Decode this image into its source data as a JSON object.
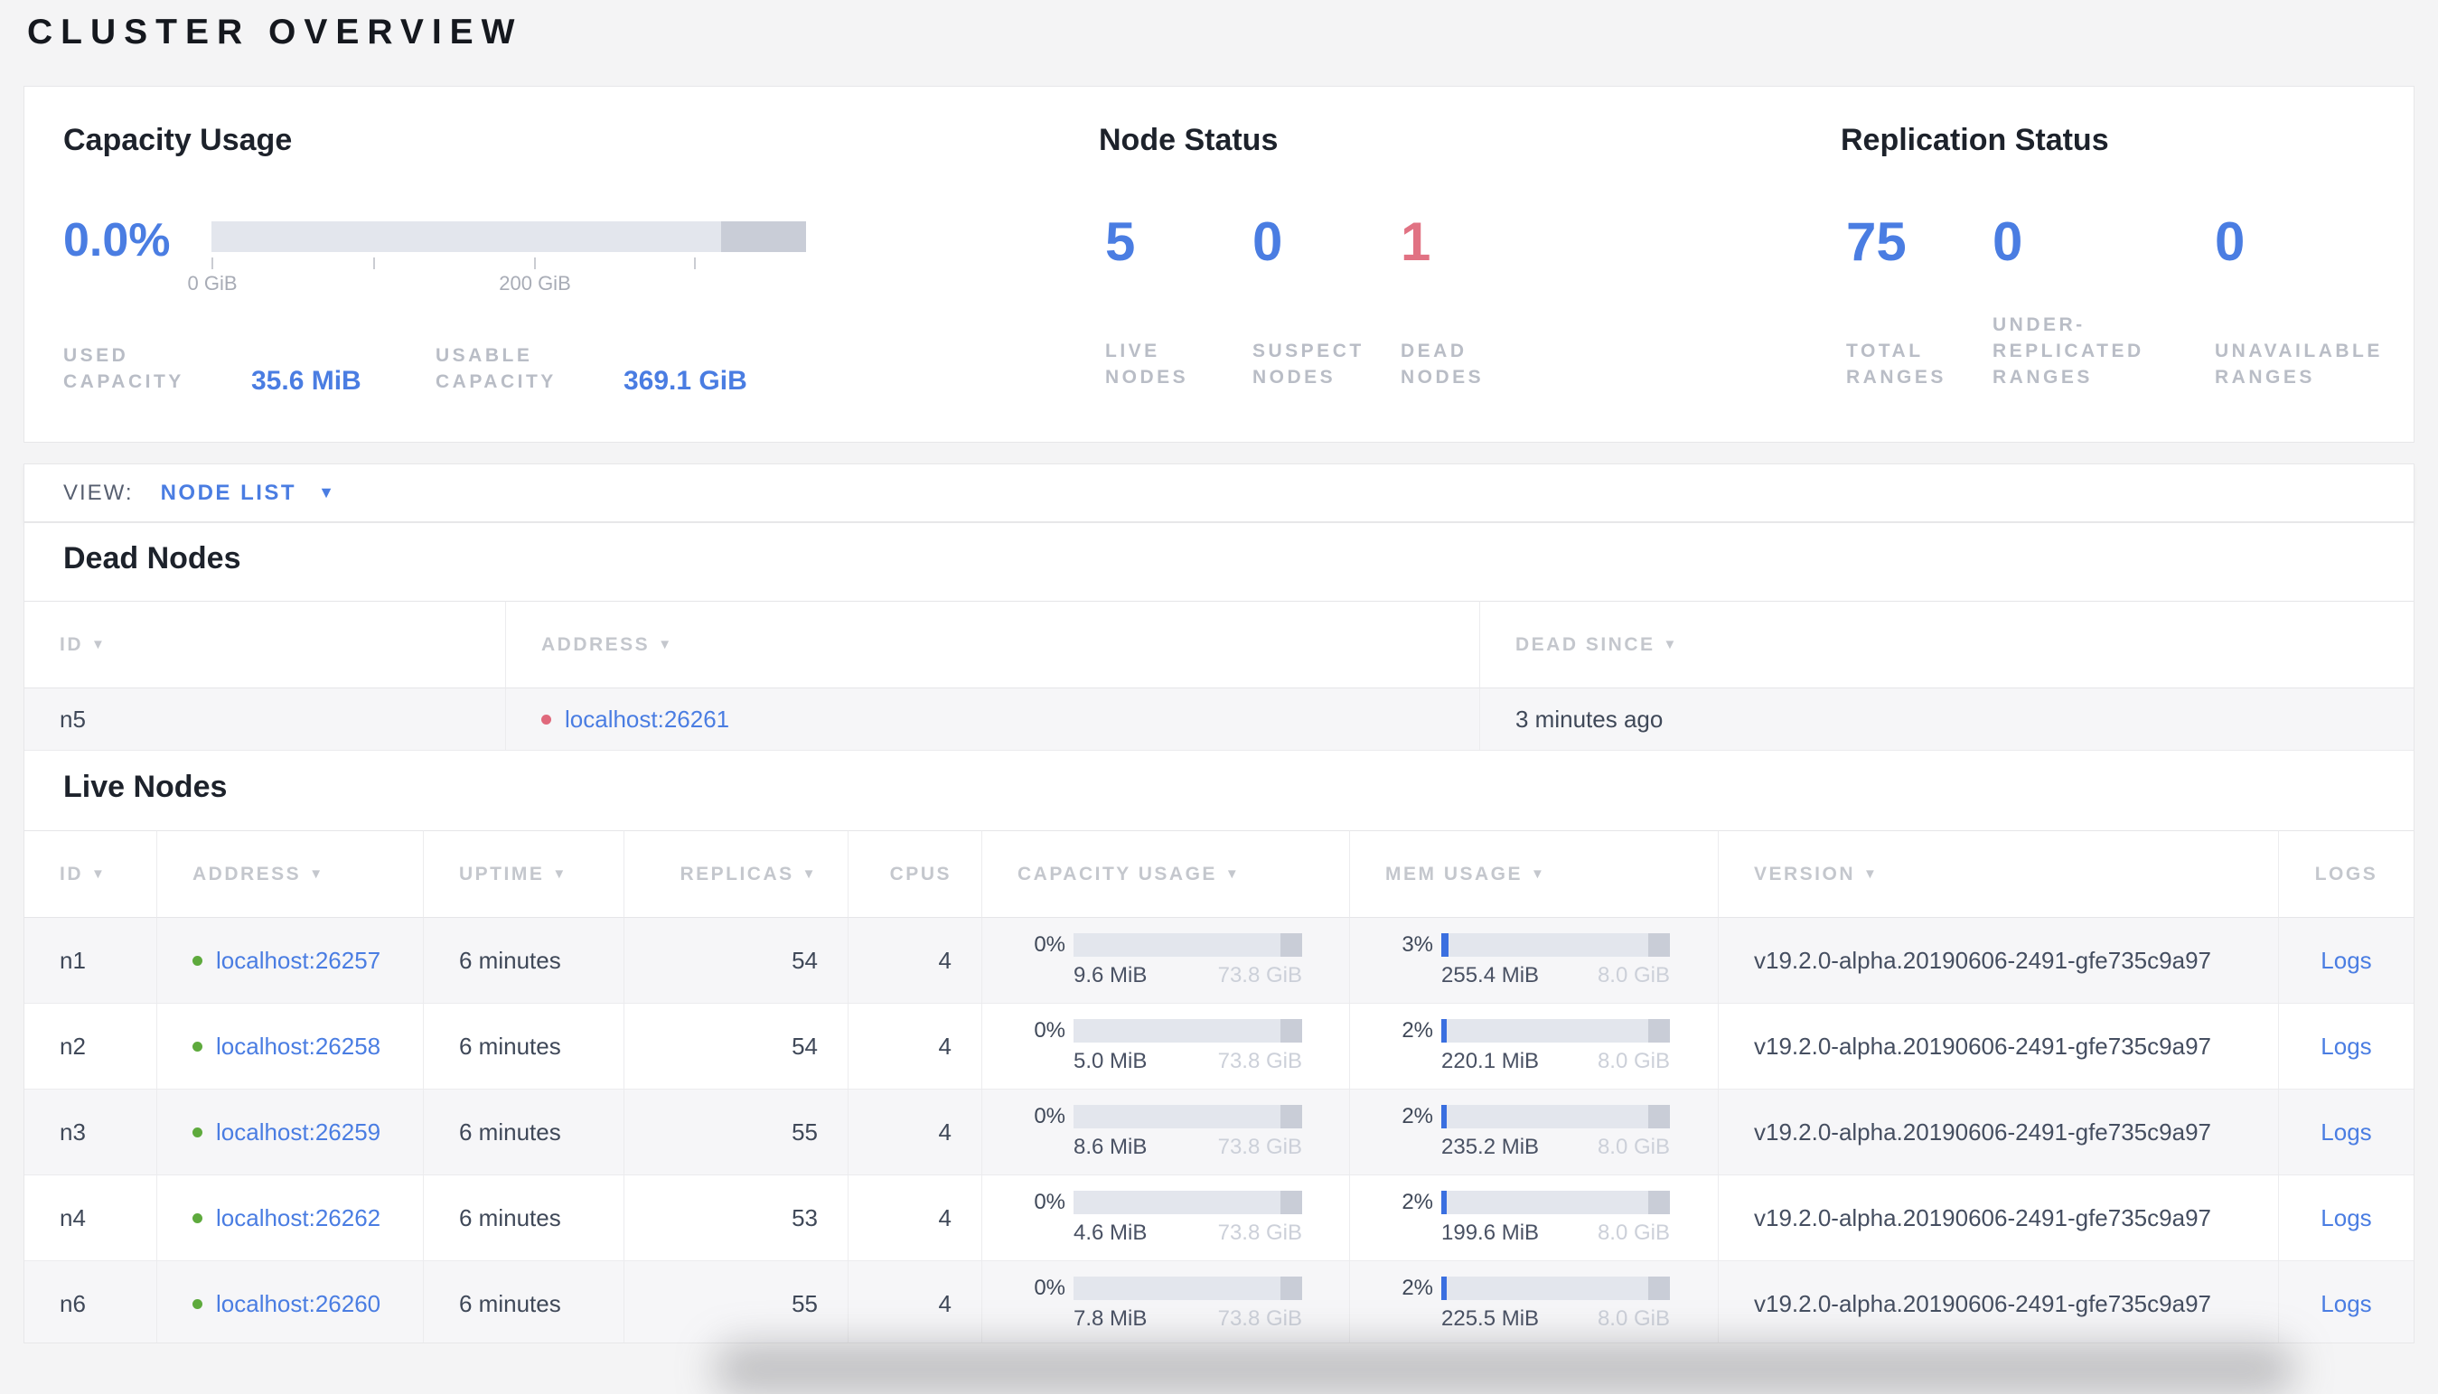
{
  "title": "CLUSTER OVERVIEW",
  "colors": {
    "accent_blue": "#4a7de2",
    "danger_red": "#e17283",
    "live_green": "#5eaa3d",
    "dead_red": "#e0697c"
  },
  "summary": {
    "capacity": {
      "heading": "Capacity Usage",
      "percent": "0.0%",
      "tick_labels": [
        "0 GiB",
        "200 GiB"
      ],
      "used_label": "USED CAPACITY",
      "used_value": "35.6 MiB",
      "usable_label": "USABLE CAPACITY",
      "usable_value": "369.1 GiB"
    },
    "nodes": {
      "heading": "Node Status",
      "stats": [
        {
          "value": "5",
          "label": "LIVE NODES"
        },
        {
          "value": "0",
          "label": "SUSPECT NODES"
        },
        {
          "value": "1",
          "label": "DEAD NODES"
        }
      ]
    },
    "replication": {
      "heading": "Replication Status",
      "stats": [
        {
          "value": "75",
          "label": "TOTAL RANGES"
        },
        {
          "value": "0",
          "label": "UNDER-REPLICATED RANGES"
        },
        {
          "value": "0",
          "label": "UNAVAILABLE RANGES"
        }
      ]
    }
  },
  "view_bar": {
    "label": "VIEW:",
    "selected": "NODE LIST"
  },
  "dead_nodes": {
    "heading": "Dead Nodes",
    "columns": [
      "ID",
      "ADDRESS",
      "DEAD SINCE"
    ],
    "rows": [
      {
        "id": "n5",
        "address": "localhost:26261",
        "dead_since": "3 minutes ago"
      }
    ]
  },
  "live_nodes": {
    "heading": "Live Nodes",
    "columns": [
      "ID",
      "ADDRESS",
      "UPTIME",
      "REPLICAS",
      "CPUS",
      "CAPACITY USAGE",
      "MEM USAGE",
      "VERSION",
      "LOGS"
    ],
    "rows": [
      {
        "id": "n1",
        "address": "localhost:26257",
        "uptime": "6 minutes",
        "replicas": "54",
        "cpus": "4",
        "capacity_percent": "0%",
        "capacity_used": "9.6 MiB",
        "capacity_total": "73.8 GiB",
        "mem_percent": "3%",
        "mem_used": "255.4 MiB",
        "mem_total": "8.0 GiB",
        "version": "v19.2.0-alpha.20190606-2491-gfe735c9a97",
        "logs": "Logs"
      },
      {
        "id": "n2",
        "address": "localhost:26258",
        "uptime": "6 minutes",
        "replicas": "54",
        "cpus": "4",
        "capacity_percent": "0%",
        "capacity_used": "5.0 MiB",
        "capacity_total": "73.8 GiB",
        "mem_percent": "2%",
        "mem_used": "220.1 MiB",
        "mem_total": "8.0 GiB",
        "version": "v19.2.0-alpha.20190606-2491-gfe735c9a97",
        "logs": "Logs"
      },
      {
        "id": "n3",
        "address": "localhost:26259",
        "uptime": "6 minutes",
        "replicas": "55",
        "cpus": "4",
        "capacity_percent": "0%",
        "capacity_used": "8.6 MiB",
        "capacity_total": "73.8 GiB",
        "mem_percent": "2%",
        "mem_used": "235.2 MiB",
        "mem_total": "8.0 GiB",
        "version": "v19.2.0-alpha.20190606-2491-gfe735c9a97",
        "logs": "Logs"
      },
      {
        "id": "n4",
        "address": "localhost:26262",
        "uptime": "6 minutes",
        "replicas": "53",
        "cpus": "4",
        "capacity_percent": "0%",
        "capacity_used": "4.6 MiB",
        "capacity_total": "73.8 GiB",
        "mem_percent": "2%",
        "mem_used": "199.6 MiB",
        "mem_total": "8.0 GiB",
        "version": "v19.2.0-alpha.20190606-2491-gfe735c9a97",
        "logs": "Logs"
      },
      {
        "id": "n6",
        "address": "localhost:26260",
        "uptime": "6 minutes",
        "replicas": "55",
        "cpus": "4",
        "capacity_percent": "0%",
        "capacity_used": "7.8 MiB",
        "capacity_total": "73.8 GiB",
        "mem_percent": "2%",
        "mem_used": "225.5 MiB",
        "mem_total": "8.0 GiB",
        "version": "v19.2.0-alpha.20190606-2491-gfe735c9a97",
        "logs": "Logs"
      }
    ]
  }
}
